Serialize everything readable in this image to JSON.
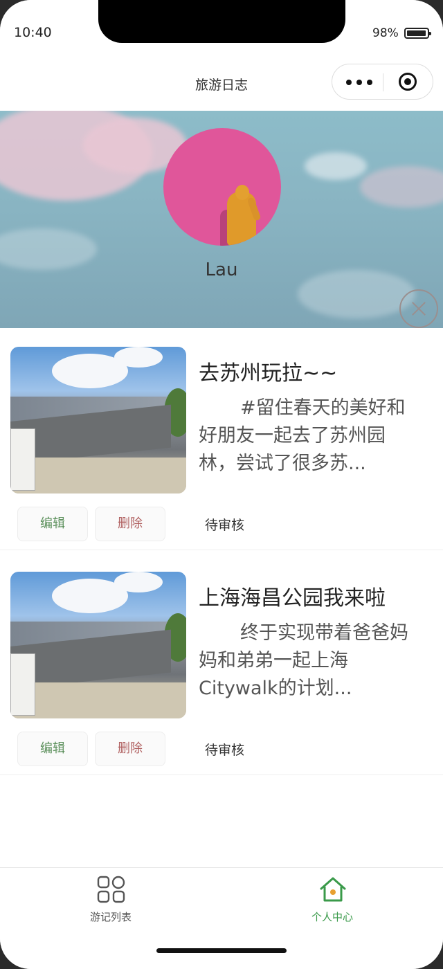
{
  "status_bar": {
    "time": "10:40",
    "battery": "98%"
  },
  "nav": {
    "title": "旅游日志",
    "more_icon": "more-dots-icon",
    "record_icon": "record-icon"
  },
  "profile": {
    "username": "Lau",
    "close_icon": "close-circle-icon"
  },
  "diaries": [
    {
      "title": "去苏州玩拉~~",
      "description": "#留住春天的美好和好朋友一起去了苏州园林，尝试了很多苏...",
      "edit_label": "编辑",
      "delete_label": "删除",
      "status": "待审核"
    },
    {
      "title": "上海海昌公园我来啦",
      "description": "终于实现带着爸爸妈妈和弟弟一起上海Citywalk的计划...",
      "edit_label": "编辑",
      "delete_label": "删除",
      "status": "待审核"
    }
  ],
  "tabs": [
    {
      "label": "游记列表",
      "icon": "grid-icon",
      "active": false
    },
    {
      "label": "个人中心",
      "icon": "home-icon",
      "active": true
    }
  ],
  "colors": {
    "accent_green": "#3a9a4a",
    "edit_green": "#5a8f5a",
    "delete_red": "#b06060",
    "avatar_pink": "#e0569a"
  }
}
